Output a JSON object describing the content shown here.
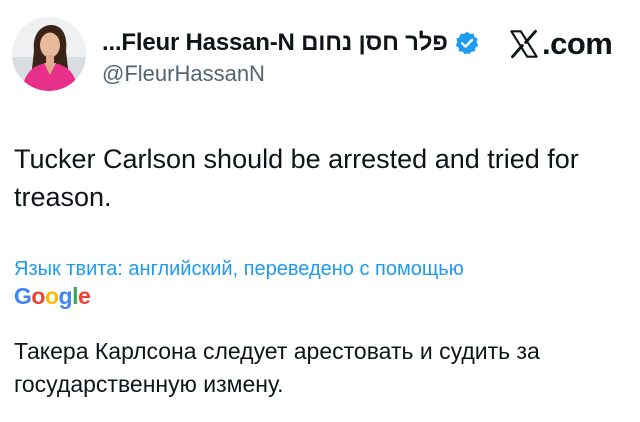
{
  "author": {
    "display_name": "...Fleur Hassan-N פלר חסן נחום",
    "handle": "@FleurHassanN",
    "verified": true
  },
  "platform": {
    "logo_icon": "x-logo-icon",
    "logo_suffix": ".com"
  },
  "tweet": {
    "text": "Tucker Carlson should be arrested and tried for treason."
  },
  "translation": {
    "note": "Язык твита: английский, переведено с помощью",
    "provider_logo": [
      "G",
      "o",
      "o",
      "g",
      "l",
      "e"
    ],
    "translated_text": "Такера Карлсона следует арестовать и судить за государственную измену."
  },
  "colors": {
    "text": "#0f1419",
    "secondary_text": "#536471",
    "link_blue": "#1d9bf0",
    "verified_blue": "#1d9bf0",
    "avatar_outfit": "#e8308a"
  }
}
